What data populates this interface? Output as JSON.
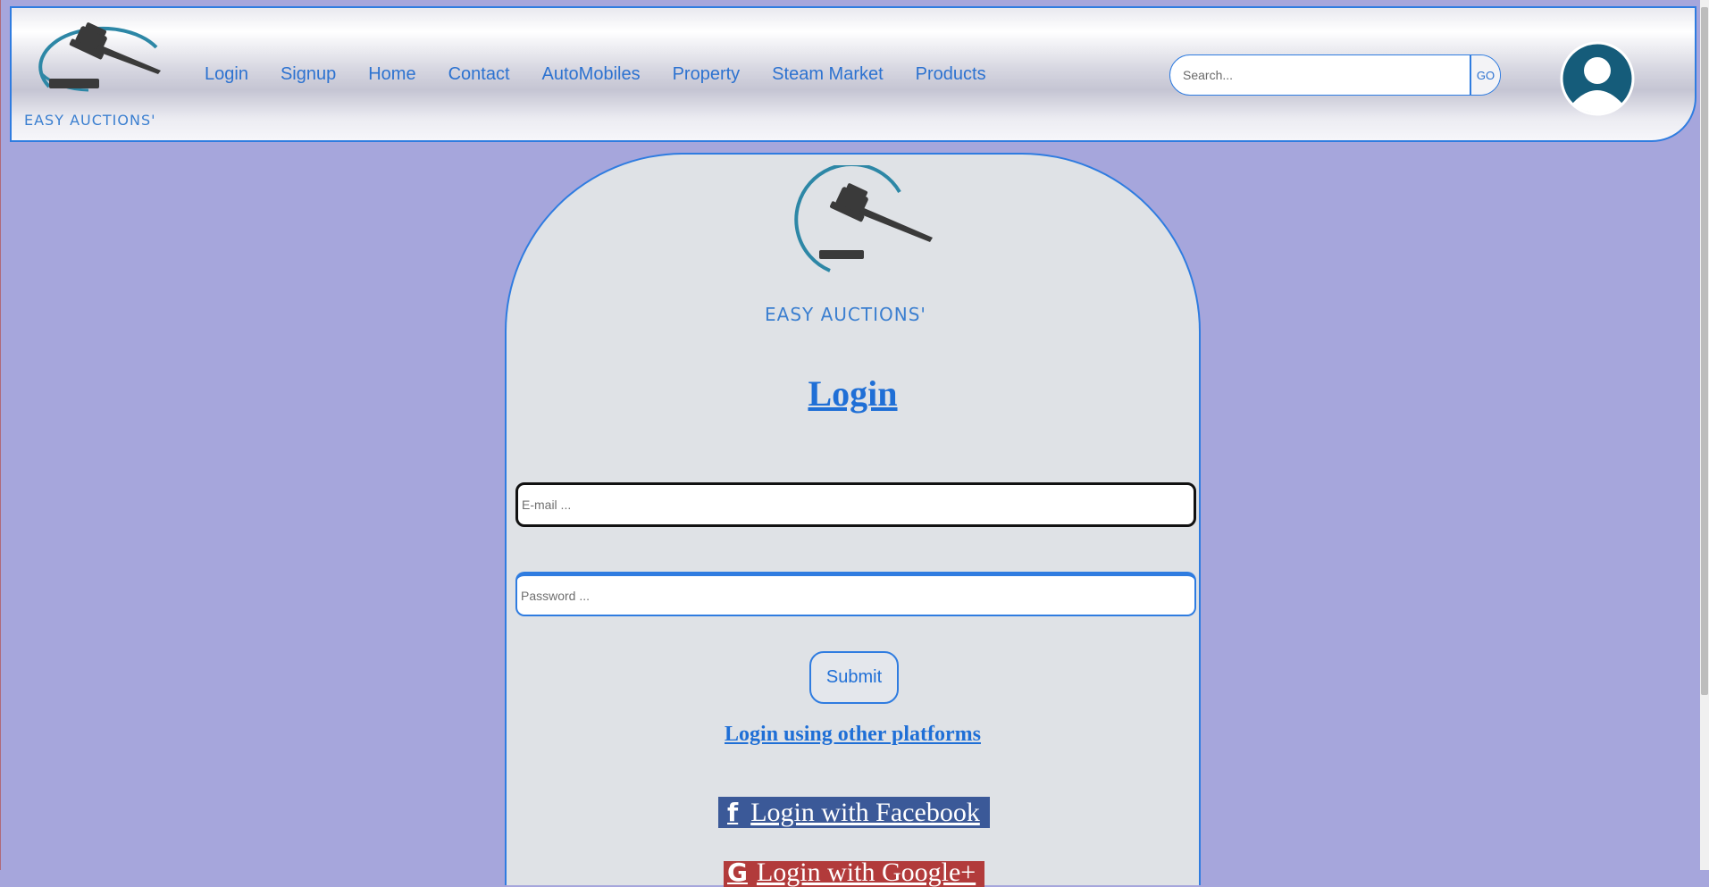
{
  "header": {
    "logo_text": "EASY AUCTIONS'",
    "nav": [
      "Login",
      "Signup",
      "Home",
      "Contact",
      "AutoMobiles",
      "Property",
      "Steam Market",
      "Products"
    ],
    "search": {
      "placeholder": "Search...",
      "button": "GO"
    }
  },
  "login": {
    "logo_text": "EASY AUCTIONS'",
    "title": "Login",
    "email_placeholder": "E-mail ...",
    "password_placeholder": "Password ...",
    "submit": "Submit",
    "other_platforms": "Login using other platforms",
    "facebook_label": "Login with Facebook",
    "facebook_icon": "f",
    "google_label": "Login with Google+",
    "google_icon": "G"
  },
  "colors": {
    "background": "#a6a6dc",
    "accent": "#2f7ce0",
    "facebook": "#3b5998",
    "google": "#b23b3b",
    "avatar": "#155c7a"
  }
}
